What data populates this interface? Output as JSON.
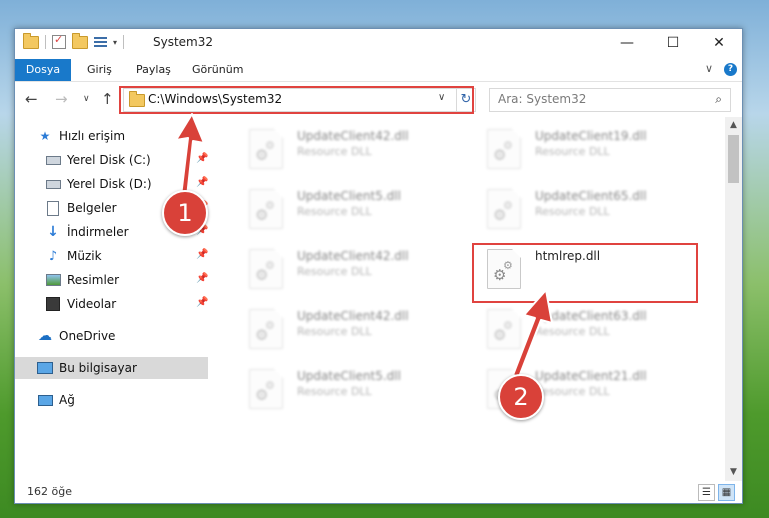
{
  "window": {
    "title": "System32",
    "controls": {
      "minimize": "—",
      "maximize": "☐",
      "close": "✕"
    }
  },
  "ribbon": {
    "file_tab": "Dosya",
    "tabs": [
      "Giriş",
      "Paylaş",
      "Görünüm"
    ],
    "expand": "∨",
    "help": "?"
  },
  "nav": {
    "back": "←",
    "forward": "→",
    "recent": "∨",
    "up": "↑",
    "address": "C:\\Windows\\System32",
    "address_dropdown": "∨",
    "refresh": "↻",
    "search_placeholder": "Ara: System32",
    "search_icon": "⌕"
  },
  "sidebar": {
    "items": [
      {
        "label": "Hızlı erişim",
        "icon": "star-icon"
      },
      {
        "label": "Yerel Disk (C:)",
        "icon": "drive-icon",
        "pinned": true
      },
      {
        "label": "Yerel Disk (D:)",
        "icon": "drive-icon",
        "pinned": true
      },
      {
        "label": "Belgeler",
        "icon": "document-icon",
        "pinned": true
      },
      {
        "label": "İndirmeler",
        "icon": "download-icon",
        "pinned": true
      },
      {
        "label": "Müzik",
        "icon": "music-icon",
        "pinned": true
      },
      {
        "label": "Resimler",
        "icon": "pictures-icon",
        "pinned": true
      },
      {
        "label": "Videolar",
        "icon": "video-icon",
        "pinned": true
      },
      {
        "label": "OneDrive",
        "icon": "cloud-icon"
      },
      {
        "label": "Bu bilgisayar",
        "icon": "computer-icon",
        "selected": true
      },
      {
        "label": "Ağ",
        "icon": "network-icon"
      }
    ]
  },
  "files": [
    {
      "name": "UpdateClient42.dll",
      "desc": "Resource DLL"
    },
    {
      "name": "UpdateClient19.dll",
      "desc": "Resource DLL"
    },
    {
      "name": "UpdateClient5.dll",
      "desc": "Resource DLL"
    },
    {
      "name": "UpdateClient65.dll",
      "desc": "Resource DLL"
    },
    {
      "name": "UpdateClient42.dll",
      "desc": "Resource DLL"
    },
    {
      "name": "htmlrep.dll",
      "desc": ""
    },
    {
      "name": "UpdateClient42.dll",
      "desc": "Resource DLL"
    },
    {
      "name": "UpdateClient63.dll",
      "desc": "Resource DLL"
    },
    {
      "name": "UpdateClient5.dll",
      "desc": "Resource DLL"
    },
    {
      "name": "UpdateClient21.dll",
      "desc": "Resource DLL"
    }
  ],
  "status": {
    "count": "162 öğe"
  },
  "annotations": {
    "step1": "1",
    "step2": "2",
    "color": "#d94139"
  },
  "colors": {
    "accent": "#1979ca",
    "highlight": "#e0433f"
  }
}
